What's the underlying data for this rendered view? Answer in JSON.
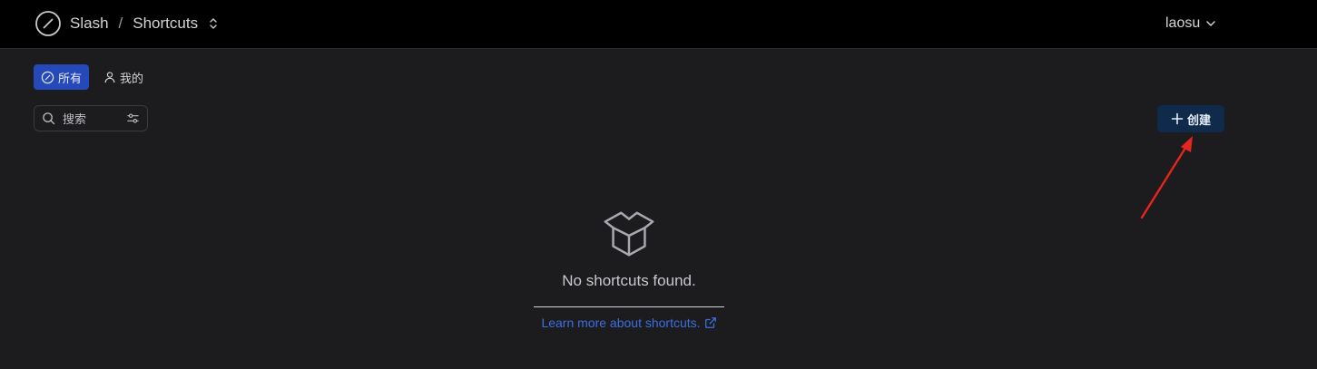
{
  "header": {
    "app_name": "Slash",
    "separator": "/",
    "section": "Shortcuts",
    "user_name": "laosu"
  },
  "tabs": [
    {
      "label": "所有",
      "active": true,
      "icon": "circle-slash-icon"
    },
    {
      "label": "我的",
      "active": false,
      "icon": "user-icon"
    }
  ],
  "search": {
    "placeholder": "搜索"
  },
  "toolbar": {
    "create_label": "创建"
  },
  "empty_state": {
    "icon": "package-icon",
    "message": "No shortcuts found.",
    "learn_more": "Learn more about shortcuts."
  },
  "colors": {
    "header_bg": "#000000",
    "page_bg": "#1c1b1e",
    "active_tab": "#2549b8",
    "create_button": "#0f2a4a",
    "link": "#3b6fe0",
    "annotation_arrow": "#e5251f"
  }
}
